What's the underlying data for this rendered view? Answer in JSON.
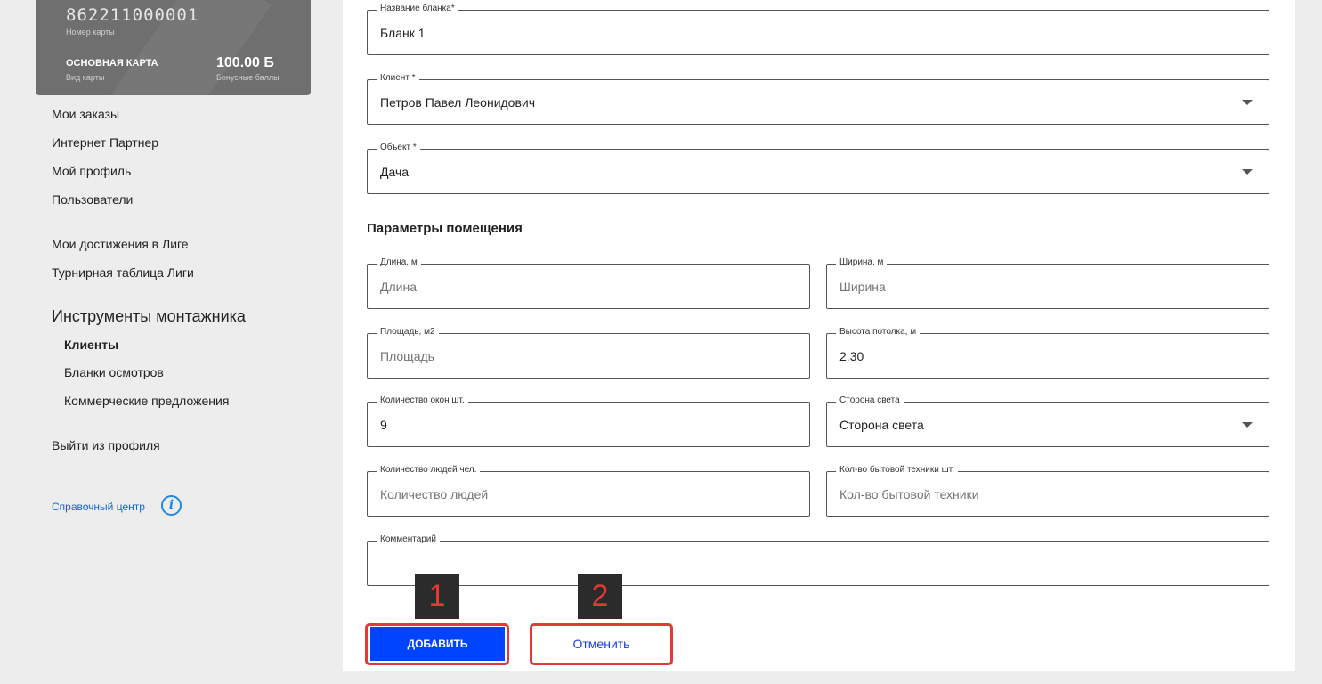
{
  "card": {
    "number": "862211000001",
    "number_label": "Номер карты",
    "type": "ОСНОВНАЯ КАРТА",
    "type_label": "Вид карты",
    "bonus": "100.00 Б",
    "bonus_label": "Бонусные баллы"
  },
  "sidebar": {
    "links": [
      "Мои заказы",
      "Интернет Партнер",
      "Мой профиль",
      "Пользователи"
    ],
    "league_links": [
      "Мои достижения в Лиге",
      "Турнирная таблица Лиги"
    ],
    "section_title": "Инструменты монтажника",
    "sub_items": [
      "Клиенты",
      "Бланки осмотров",
      "Коммерческие предложения"
    ],
    "logout": "Выйти из профиля",
    "help": "Справочный центр",
    "help_icon": "info-icon"
  },
  "form": {
    "name": {
      "label": "Название бланка*",
      "value": "Бланк 1"
    },
    "client": {
      "label": "Клиент *",
      "value": "Петров Павел Леонидович"
    },
    "object": {
      "label": "Объект *",
      "value": "Дача"
    },
    "section_title": "Параметры помещения",
    "length": {
      "label": "Длина, м",
      "placeholder": "Длина"
    },
    "width": {
      "label": "Ширина, м",
      "placeholder": "Ширина"
    },
    "area": {
      "label": "Площадь, м2",
      "placeholder": "Площадь"
    },
    "height": {
      "label": "Высота потолка, м",
      "value": "2.30"
    },
    "windows": {
      "label": "Количество окон шт.",
      "value": "9"
    },
    "side": {
      "label": "Сторона света",
      "value": "Сторона света"
    },
    "people": {
      "label": "Количество людей чел.",
      "placeholder": "Количество людей"
    },
    "appliances": {
      "label": "Кол-во бытовой техники шт.",
      "placeholder": "Кол-во бытовой техники"
    },
    "comment": {
      "label": "Комментарий",
      "value": ""
    }
  },
  "buttons": {
    "add": "ДОБАВИТЬ",
    "cancel": "Отменить"
  },
  "annotations": {
    "marker_1": "1",
    "marker_2": "2",
    "highlight_color": "#e53935"
  },
  "colors": {
    "primary": "#0044ff",
    "link": "#1565d8"
  }
}
